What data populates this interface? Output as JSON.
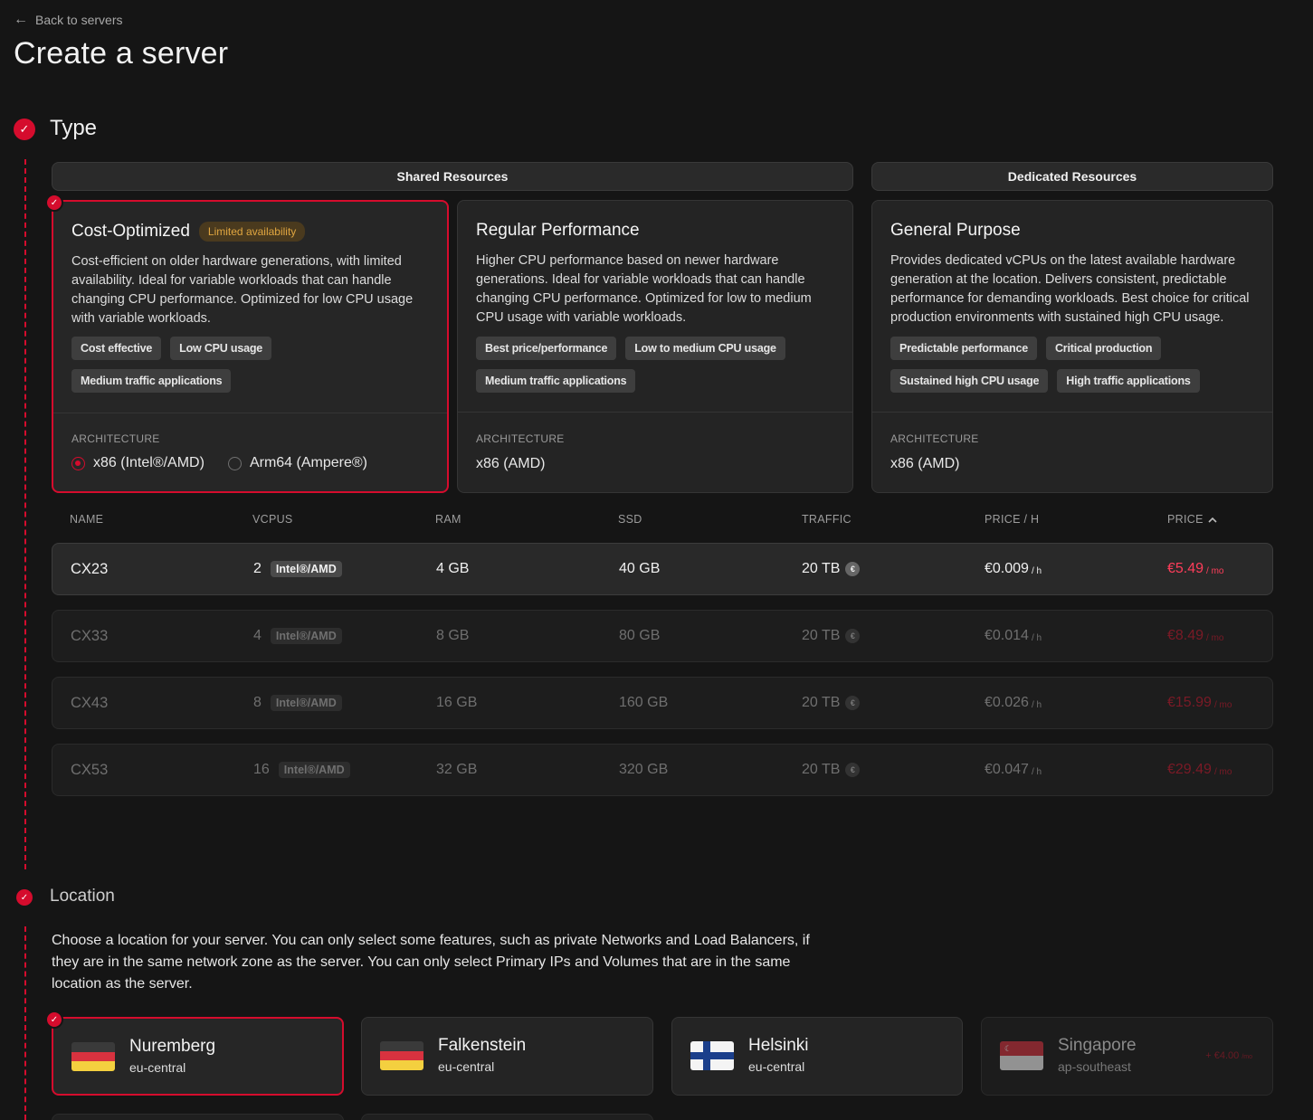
{
  "header": {
    "back_label": "Back to servers",
    "title": "Create a server"
  },
  "steps": {
    "type_title": "Type",
    "location_title": "Location"
  },
  "groups": {
    "shared": "Shared Resources",
    "dedicated": "Dedicated Resources"
  },
  "type_cards": [
    {
      "title": "Cost-Optimized",
      "badge": "Limited availability",
      "description": "Cost-efficient on older hardware generations, with limited availability. Ideal for variable workloads that can handle changing CPU performance. Optimized for low CPU usage with variable workloads.",
      "tags": [
        "Cost effective",
        "Low CPU usage",
        "Medium traffic applications"
      ],
      "arch_label": "ARCHITECTURE",
      "arch_options": [
        "x86 (Intel®/AMD)",
        "Arm64 (Ampere®)"
      ],
      "selected": true
    },
    {
      "title": "Regular Performance",
      "description": "Higher CPU performance based on newer hardware generations. Ideal for variable workloads that can handle changing CPU performance. Optimized for low to medium CPU usage with variable workloads.",
      "tags": [
        "Best price/performance",
        "Low to medium CPU usage",
        "Medium traffic applications"
      ],
      "arch_label": "ARCHITECTURE",
      "arch_value": "x86 (AMD)"
    },
    {
      "title": "General Purpose",
      "description": "Provides dedicated vCPUs on the latest available hardware generation at the location. Delivers consistent, predictable performance for demanding workloads. Best choice for critical production environments with sustained high CPU usage.",
      "tags": [
        "Predictable performance",
        "Critical production",
        "Sustained high CPU usage",
        "High traffic applications"
      ],
      "arch_label": "ARCHITECTURE",
      "arch_value": "x86 (AMD)"
    }
  ],
  "table": {
    "headers": [
      "NAME",
      "VCPUS",
      "RAM",
      "SSD",
      "TRAFFIC",
      "PRICE / H",
      "PRICE"
    ],
    "sort_icon": "chevron-up-icon",
    "currency_icon": "€",
    "hour_unit": "/ h",
    "month_unit": "/ mo",
    "rows": [
      {
        "name": "CX23",
        "vcpus": "2",
        "cpu": "Intel®/AMD",
        "ram": "4 GB",
        "ssd": "40 GB",
        "traffic": "20 TB",
        "price_h": "€0.009",
        "price_mo": "€5.49",
        "selected": true
      },
      {
        "name": "CX33",
        "vcpus": "4",
        "cpu": "Intel®/AMD",
        "ram": "8 GB",
        "ssd": "80 GB",
        "traffic": "20 TB",
        "price_h": "€0.014",
        "price_mo": "€8.49"
      },
      {
        "name": "CX43",
        "vcpus": "8",
        "cpu": "Intel®/AMD",
        "ram": "16 GB",
        "ssd": "160 GB",
        "traffic": "20 TB",
        "price_h": "€0.026",
        "price_mo": "€15.99"
      },
      {
        "name": "CX53",
        "vcpus": "16",
        "cpu": "Intel®/AMD",
        "ram": "32 GB",
        "ssd": "320 GB",
        "traffic": "20 TB",
        "price_h": "€0.047",
        "price_mo": "€29.49"
      }
    ]
  },
  "location": {
    "description": "Choose a location for your server. You can only select some features, such as private Networks and Load Balancers, if they are in the same network zone as the server. You can only select Primary IPs and Volumes that are in the same location as the server.",
    "cards": [
      {
        "name": "Nuremberg",
        "zone": "eu-central",
        "flag": "germany-flag-icon",
        "selected": true
      },
      {
        "name": "Falkenstein",
        "zone": "eu-central",
        "flag": "germany-flag-icon"
      },
      {
        "name": "Helsinki",
        "zone": "eu-central",
        "flag": "finland-flag-icon"
      },
      {
        "name": "Singapore",
        "zone": "ap-southeast",
        "flag": "singapore-flag-icon",
        "extra_price": "+ €4.00",
        "extra_unit": "/mo",
        "disabled": true
      }
    ]
  },
  "colors": {
    "accent": "#d50c2d",
    "background": "#151515",
    "card": "#242424",
    "warning": "#e0a640"
  }
}
